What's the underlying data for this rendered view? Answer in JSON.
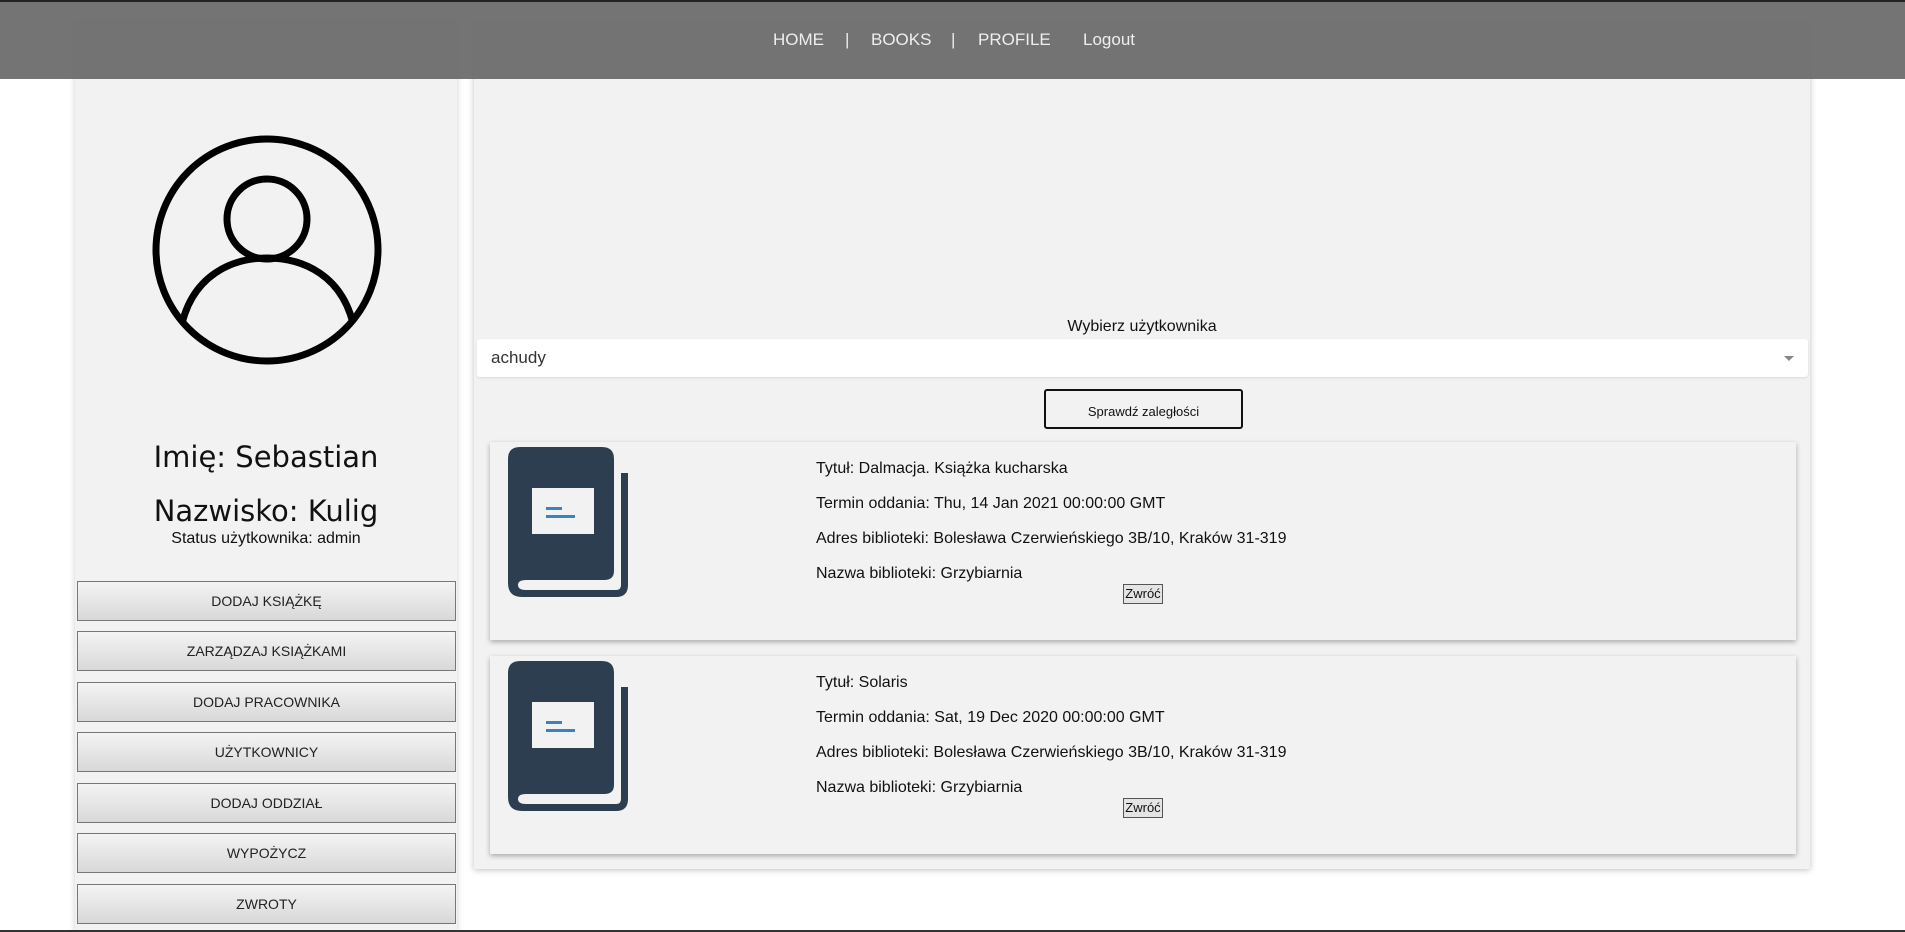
{
  "nav": {
    "items": [
      "HOME",
      "|",
      "BOOKS",
      "|",
      "PROFILE",
      "Logout"
    ]
  },
  "profile": {
    "first_name": "Imię: Sebastian",
    "last_name": "Nazwisko: Kulig",
    "status": "Status użytkownika: admin"
  },
  "sidebar": {
    "buttons": [
      "DODAJ KSIĄŻKĘ",
      "ZARZĄDZAJ KSIĄŻKAMI",
      "DODAJ PRACOWNIKA",
      "UŻYTKOWNICY",
      "DODAJ ODDZIAŁ",
      "WYPOŻYCZ",
      "ZWROTY"
    ]
  },
  "main": {
    "select_label": "Wybierz użytkownika",
    "selected_user": "achudy",
    "check_button": "Sprawdź zaległości",
    "loans": [
      {
        "title": "Tytuł: Dalmacja. Książka kucharska",
        "due": "Termin oddania: Thu, 14 Jan 2021 00:00:00 GMT",
        "address": "Adres biblioteki: Bolesława Czerwieńskiego 3B/10, Kraków 31-319",
        "library": "Nazwa biblioteki: Grzybiarnia",
        "return_label": "Zwróć"
      },
      {
        "title": "Tytuł: Solaris",
        "due": "Termin oddania: Sat, 19 Dec 2020 00:00:00 GMT",
        "address": "Adres biblioteki: Bolesława Czerwieńskiego 3B/10, Kraków 31-319",
        "library": "Nazwa biblioteki: Grzybiarnia",
        "return_label": "Zwróć"
      }
    ]
  },
  "colors": {
    "nav_bg": "#696969",
    "book_icon": "#2d3e50",
    "book_lines": "#3b82c4"
  }
}
